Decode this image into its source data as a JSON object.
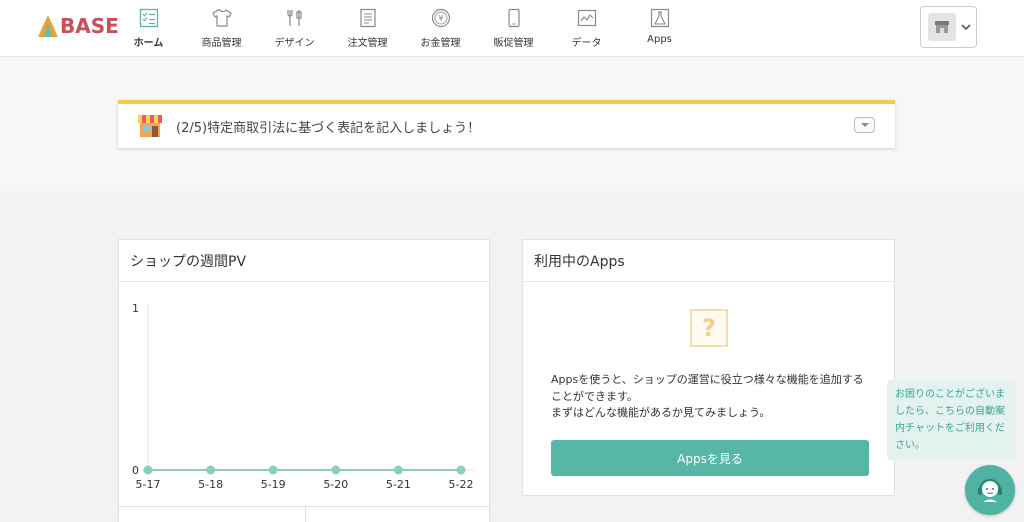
{
  "header": {
    "logo_text": "BASE",
    "nav": [
      {
        "label": "ホーム",
        "icon": "checklist-icon",
        "active": true
      },
      {
        "label": "商品管理",
        "icon": "tshirt-icon"
      },
      {
        "label": "デザイン",
        "icon": "tools-icon"
      },
      {
        "label": "注文管理",
        "icon": "document-icon"
      },
      {
        "label": "お金管理",
        "icon": "yen-coin-icon"
      },
      {
        "label": "販促管理",
        "icon": "smartphone-icon"
      },
      {
        "label": "データ",
        "icon": "line-graph-icon"
      },
      {
        "label": "Apps",
        "icon": "flask-icon"
      }
    ]
  },
  "notice": {
    "text": "(2/5)特定商取引法に基づく表記を記入しましょう！"
  },
  "pv_card": {
    "title": "ショップの週間PV"
  },
  "chart_data": {
    "type": "line",
    "categories": [
      "5-17",
      "5-18",
      "5-19",
      "5-20",
      "5-21",
      "5-22"
    ],
    "values": [
      0,
      0,
      0,
      0,
      0,
      0
    ],
    "ylim": [
      0,
      1
    ],
    "yticks": [
      "0",
      "1"
    ],
    "color": "#8ccdbf"
  },
  "apps_card": {
    "title": "利用中のApps",
    "icon_glyph": "?",
    "desc_1": "Appsを使うと、ショップの運営に役立つ様々な機能を追加することができます。",
    "desc_2": "まずはどんな機能があるか見てみましょう。",
    "button_label": "Appsを見る"
  },
  "chat": {
    "message": "お困りのことがございましたら、こちらの自動案内チャットをご利用ください。"
  },
  "colors": {
    "accent": "#56b7a7",
    "notice_border": "#f5cc4e"
  }
}
